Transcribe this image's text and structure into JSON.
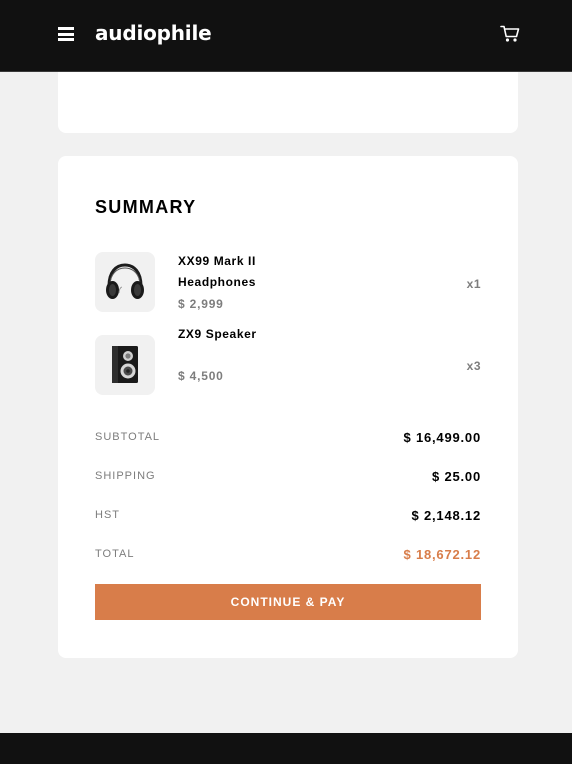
{
  "header": {
    "logo": "audiophile",
    "menu_icon": "hamburger-menu-icon",
    "cart_icon": "shopping-cart-icon"
  },
  "summary": {
    "title": "SUMMARY",
    "items": [
      {
        "name": "XX99 Mark II Headphones",
        "price": "$ 2,999",
        "qty": "x1",
        "image_icon": "headphones-icon"
      },
      {
        "name": "ZX9 Speaker",
        "price": "$ 4,500",
        "qty": "x3",
        "image_icon": "speaker-icon"
      }
    ],
    "totals": [
      {
        "label": "SUBTOTAL",
        "value": "$ 16,499.00"
      },
      {
        "label": "SHIPPING",
        "value": "$ 25.00"
      },
      {
        "label": "HST",
        "value": "$ 2,148.12"
      },
      {
        "label": "TOTAL",
        "value": "$ 18,672.12"
      }
    ],
    "button_label": "CONTINUE & PAY"
  },
  "colors": {
    "accent": "#d87d4a",
    "header_bg": "#111111",
    "page_bg": "#f1f1f1"
  }
}
